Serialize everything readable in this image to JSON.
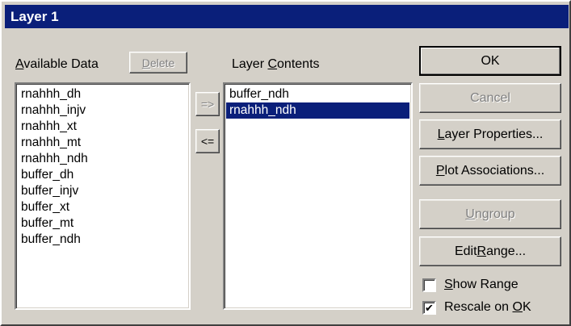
{
  "window": {
    "title": "Layer 1"
  },
  "available": {
    "label_underlined": "A",
    "label_rest": "vailable Data",
    "items": [
      "rnahhh_dh",
      "rnahhh_injv",
      "rnahhh_xt",
      "rnahhh_mt",
      "rnahhh_ndh",
      "buffer_dh",
      "buffer_injv",
      "buffer_xt",
      "buffer_mt",
      "buffer_ndh"
    ]
  },
  "delete_button": {
    "underlined": "D",
    "rest": "elete"
  },
  "move_right_button": "=>",
  "move_left_button": "<=",
  "layer": {
    "label_prefix": "Layer ",
    "label_underlined": "C",
    "label_rest": "ontents",
    "items": [
      "buffer_ndh",
      "rnahhh_ndh"
    ],
    "selected": "rnahhh_ndh"
  },
  "buttons": {
    "ok": "OK",
    "cancel": "Cancel",
    "layer_properties": {
      "underlined": "L",
      "rest": "ayer Properties..."
    },
    "plot_associations": {
      "underlined": "P",
      "rest": "lot Associations..."
    },
    "ungroup": {
      "underlined": "U",
      "rest": "ngroup"
    },
    "edit_range": {
      "prefix": "Edit ",
      "underlined": "R",
      "rest": "ange..."
    }
  },
  "checkboxes": {
    "show_range": {
      "underlined": "S",
      "rest": "how Range",
      "checked": false
    },
    "rescale": {
      "prefix": "Rescale on ",
      "underlined": "O",
      "rest": "K",
      "checked": true,
      "mark": "✔"
    }
  }
}
